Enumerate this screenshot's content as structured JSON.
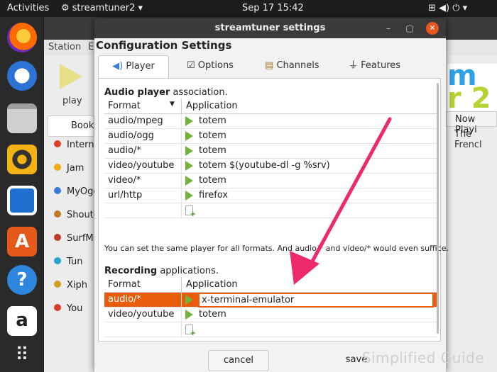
{
  "topbar": {
    "activities": "Activities",
    "app": "streamtuner2 ▾",
    "datetime": "Sep 17  15:42",
    "status_icons": "⊞  ◀)  ⏻ ▾"
  },
  "dock": {
    "icons": [
      "firefox-icon",
      "thunderbird-icon",
      "files-icon",
      "rhythmbox-icon",
      "writer-icon",
      "software-icon",
      "help-icon",
      "amazon-icon",
      "apps-grid-icon"
    ],
    "amazon_glyph": "a",
    "help_glyph": "?"
  },
  "mainwin": {
    "menu_station": "Station",
    "menu_e": "E",
    "play_label": "play",
    "bookmarks": "Bookm",
    "channels": [
      "Interne",
      "Jam",
      "MyOgg",
      "Shoutca",
      "SurfM",
      "Tun",
      "Xiph",
      "You"
    ],
    "now_playing": "Now Playi",
    "now_playing_value": "The Frencl",
    "logo_text": "m",
    "logo_num": "r 2"
  },
  "dialog": {
    "title": "streamtuner settings",
    "heading": "Configuration Settings",
    "tabs": [
      "Player",
      "Options",
      "Channels",
      "Features"
    ],
    "audio_section": {
      "bold": "Audio player",
      "rest": " association."
    },
    "col_format": "Format",
    "col_application": "Application",
    "players": [
      {
        "format": "audio/mpeg",
        "app": "totem"
      },
      {
        "format": "audio/ogg",
        "app": "totem"
      },
      {
        "format": "audio/*",
        "app": "totem"
      },
      {
        "format": "video/youtube",
        "app": "totem $(youtube-dl -g %srv)"
      },
      {
        "format": "video/*",
        "app": "totem"
      },
      {
        "format": "url/http",
        "app": "firefox"
      }
    ],
    "note": "You can set the same player for all formats. And audio/* and video/* would even suffice.",
    "rec_section": {
      "bold": "Recording",
      "rest": " applications."
    },
    "recording": [
      {
        "format": "audio/*",
        "app": "x-terminal-emulator"
      },
      {
        "format": "video/youtube",
        "app": "totem"
      }
    ],
    "cancel": "cancel",
    "save": "save"
  },
  "watermark": "Simplified Guide",
  "colors": {
    "accent": "#e85c0c",
    "arrow": "#ee2a6e",
    "play": "#74b33a"
  }
}
